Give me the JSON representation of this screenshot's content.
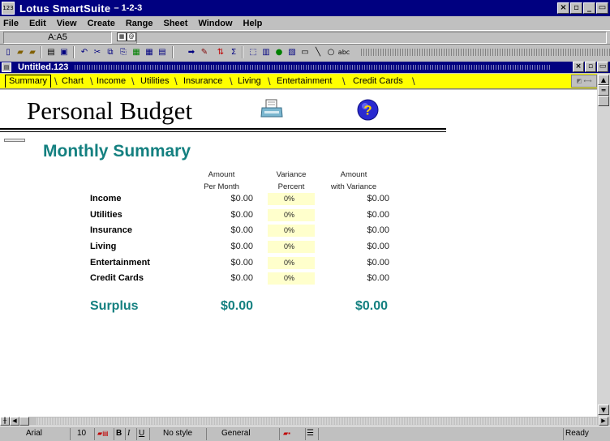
{
  "window": {
    "app_title": "Lotus SmartSuite",
    "app_subtitle": "– 1-2-3",
    "controls": [
      "×",
      "▫",
      "_",
      "▭"
    ]
  },
  "menu": [
    {
      "label": "File"
    },
    {
      "label": "Edit"
    },
    {
      "label": "View"
    },
    {
      "label": "Create"
    },
    {
      "label": "Range"
    },
    {
      "label": "Sheet"
    },
    {
      "label": "Window"
    },
    {
      "label": "Help"
    }
  ],
  "cellref": {
    "value": "A:A5",
    "contents": ""
  },
  "document": {
    "title": "Untitled.123"
  },
  "tabs": [
    {
      "label": "Summary",
      "active": true
    },
    {
      "label": "Chart"
    },
    {
      "label": "Income"
    },
    {
      "label": "Utilities"
    },
    {
      "label": "Insurance"
    },
    {
      "label": "Living"
    },
    {
      "label": "Entertainment"
    },
    {
      "label": "Credit Cards"
    }
  ],
  "sheet": {
    "heading": "Personal Budget",
    "subheading": "Monthly Summary",
    "columns": {
      "amount": [
        "Amount",
        "Per Month"
      ],
      "variance": [
        "Variance",
        "Percent"
      ],
      "with_variance": [
        "Amount",
        "with Variance"
      ]
    },
    "rows": [
      {
        "label": "Income",
        "amount": "$0.00",
        "variance": "0%",
        "with_variance": "$0.00"
      },
      {
        "label": "Utilities",
        "amount": "$0.00",
        "variance": "0%",
        "with_variance": "$0.00"
      },
      {
        "label": "Insurance",
        "amount": "$0.00",
        "variance": "0%",
        "with_variance": "$0.00"
      },
      {
        "label": "Living",
        "amount": "$0.00",
        "variance": "0%",
        "with_variance": "$0.00"
      },
      {
        "label": "Entertainment",
        "amount": "$0.00",
        "variance": "0%",
        "with_variance": "$0.00"
      },
      {
        "label": "Credit Cards",
        "amount": "$0.00",
        "variance": "0%",
        "with_variance": "$0.00"
      }
    ],
    "surplus": {
      "label": "Surplus",
      "amount": "$0.00",
      "with_variance": "$0.00"
    }
  },
  "status": {
    "font": "Arial",
    "size": "10",
    "style": "No style",
    "format": "General",
    "mode": "Ready"
  },
  "colors": {
    "title_bar": "#000080",
    "tab_bar": "#ffff00",
    "teal_text": "#148080",
    "variance_fill": "#ffffcc"
  }
}
